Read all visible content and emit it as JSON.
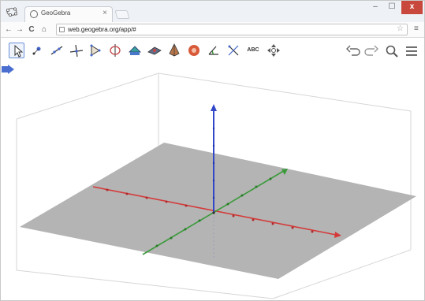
{
  "browser": {
    "tab_title": "GeoGebra",
    "tab_close": "×",
    "url": "web.geogebra.org/app/#",
    "window_controls": {
      "minimize": "–",
      "maximize": "☐",
      "close": "x"
    }
  },
  "navbar": {
    "back": "←",
    "forward": "→",
    "reload": "C",
    "home": "⌂",
    "bookmark": "☆",
    "menu": "≡"
  },
  "toolbar": {
    "tools": [
      {
        "id": "move",
        "icon": "cursor-icon",
        "selected": true
      },
      {
        "id": "point",
        "icon": "point-icon"
      },
      {
        "id": "line",
        "icon": "line-icon"
      },
      {
        "id": "perpendicular",
        "icon": "perpendicular-line-icon"
      },
      {
        "id": "polygon",
        "icon": "polygon-icon"
      },
      {
        "id": "circle-axis",
        "icon": "circle-around-axis-icon"
      },
      {
        "id": "intersect",
        "icon": "intersect-icon"
      },
      {
        "id": "plane",
        "icon": "plane-icon"
      },
      {
        "id": "pyramid",
        "icon": "pyramid-icon"
      },
      {
        "id": "sphere",
        "icon": "sphere-icon"
      },
      {
        "id": "angle",
        "icon": "angle-icon"
      },
      {
        "id": "reflect",
        "icon": "reflect-icon"
      },
      {
        "id": "text",
        "icon": "text-icon",
        "label": "ABC"
      },
      {
        "id": "rotate-view",
        "icon": "rotate-view-icon"
      }
    ],
    "right": [
      {
        "id": "undo",
        "icon": "undo-icon"
      },
      {
        "id": "redo",
        "icon": "redo-icon"
      },
      {
        "id": "search",
        "icon": "search-icon"
      },
      {
        "id": "menu",
        "icon": "hamburger-menu-icon"
      }
    ]
  },
  "view3d": {
    "axes": [
      {
        "name": "x",
        "color": "#d43a3a"
      },
      {
        "name": "y",
        "color": "#3a9a3a"
      },
      {
        "name": "z",
        "color": "#3347c9"
      }
    ],
    "plane_color": "#b4b4b4",
    "box_color": "#d0d0d0"
  }
}
